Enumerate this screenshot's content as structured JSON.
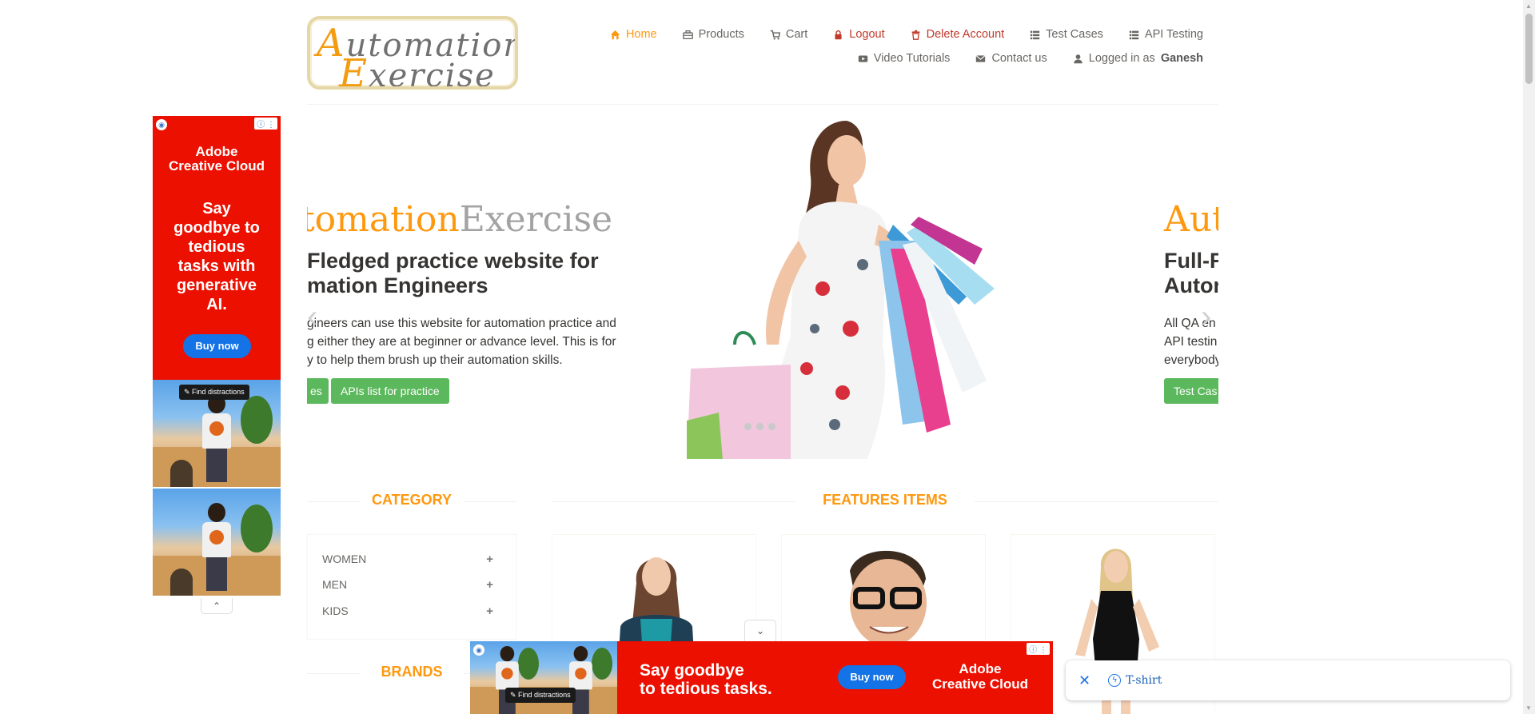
{
  "logo": {
    "line1_cap": "A",
    "line1_rest": "utomation",
    "line2_cap": "E",
    "line2_rest": "xercise"
  },
  "nav": {
    "row1": [
      {
        "label": "Home",
        "icon": "home-icon",
        "state": "active"
      },
      {
        "label": "Products",
        "icon": "briefcase-icon"
      },
      {
        "label": "Cart",
        "icon": "cart-icon"
      },
      {
        "label": "Logout",
        "icon": "lock-icon",
        "state": "red"
      },
      {
        "label": "Delete Account",
        "icon": "trash-icon",
        "state": "red"
      },
      {
        "label": "Test Cases",
        "icon": "list-icon"
      },
      {
        "label": "API Testing",
        "icon": "list-icon"
      }
    ],
    "row2": [
      {
        "label": "Video Tutorials",
        "icon": "youtube-icon"
      },
      {
        "label": "Contact us",
        "icon": "envelope-icon"
      }
    ],
    "logged_in_prefix": "Logged in as",
    "logged_in_user": "Ganesh"
  },
  "left_ad": {
    "brand_line1": "Adobe",
    "brand_line2": "Creative Cloud",
    "slogan_lines": [
      "Say",
      "goodbye to",
      "tedious",
      "tasks with",
      "generative",
      "AI."
    ],
    "button": "Buy now",
    "find_label": "Find distractions",
    "info_label": "ⓘ ⋮"
  },
  "slider": {
    "title_orange_left": "tomation",
    "title_gray_left": "Exercise",
    "heading_line1_left": "Fledged practice website for",
    "heading_line2_left": "mation Engineers",
    "para_left": [
      "gineers can use this website for automation practice and",
      "g either they are at beginner or advance level. This is for",
      "y to help them brush up their automation skills."
    ],
    "btn1_left": "es",
    "btn2_left": "APIs list for practice",
    "title_orange_right": "Aut",
    "heading_line1_right": "Full-F",
    "heading_line2_right": "Autor",
    "para_right": [
      "All QA en",
      "API testin",
      "everybody"
    ],
    "btn_right": "Test Cas",
    "prev_arrow": "‹",
    "next_arrow": "›"
  },
  "sections": {
    "category": "CATEGORY",
    "features": "FEATURES ITEMS",
    "brands": "BRANDS"
  },
  "categories": [
    {
      "label": "WOMEN",
      "toggle": "+"
    },
    {
      "label": "MEN",
      "toggle": "+"
    },
    {
      "label": "KIDS",
      "toggle": "+"
    }
  ],
  "bottom_ad": {
    "slogan_line1": "Say goodbye",
    "slogan_line2": "to tedious tasks.",
    "button": "Buy now",
    "brand_line1": "Adobe",
    "brand_line2": "Creative Cloud",
    "find_label": "Find distractions",
    "info_label": "ⓘ ⋮",
    "collapse": "⌄",
    "expand": "⌃"
  },
  "search_chip": {
    "close": "✕",
    "bolt": "ϟ",
    "term": "T-shirt"
  },
  "colors": {
    "accent": "#fe980f",
    "green": "#5cb85c",
    "ad_red": "#eb1000",
    "ad_blue": "#1473e6"
  }
}
